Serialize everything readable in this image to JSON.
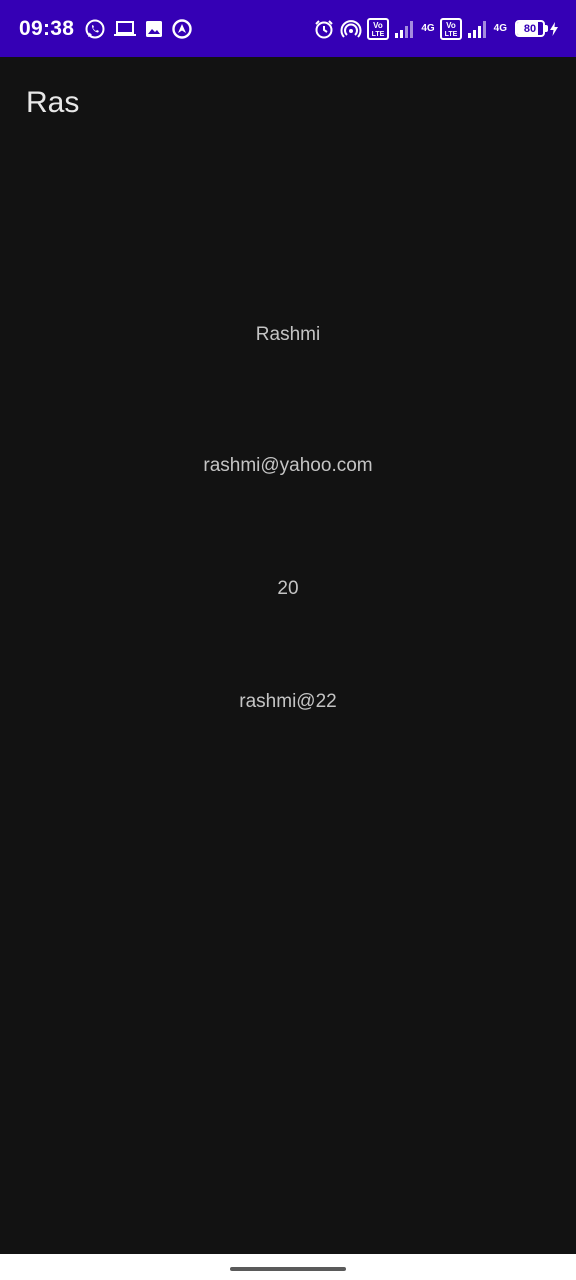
{
  "status_bar": {
    "time": "09:38",
    "left_icons": [
      "whatsapp-icon",
      "laptop-icon",
      "image-icon",
      "location-sharing-icon"
    ],
    "right_icons": [
      "alarm-icon",
      "hotspot-icon",
      "volte-icon",
      "signal-icon",
      "4g-icon",
      "volte-icon",
      "signal-icon",
      "4g-icon",
      "battery-icon",
      "charging-icon"
    ],
    "network_1": "4G",
    "network_2": "4G",
    "volte_1": "Vo LTE",
    "volte_2": "Vo LTE",
    "battery_level": "80",
    "color": "#3500b5"
  },
  "app_bar": {
    "title": "Ras"
  },
  "profile": {
    "name": "Rashmi",
    "email": "rashmi@yahoo.com",
    "age": "20",
    "password": "rashmi@22"
  },
  "theme": {
    "background": "#121212",
    "text": "#c4c4c4"
  }
}
